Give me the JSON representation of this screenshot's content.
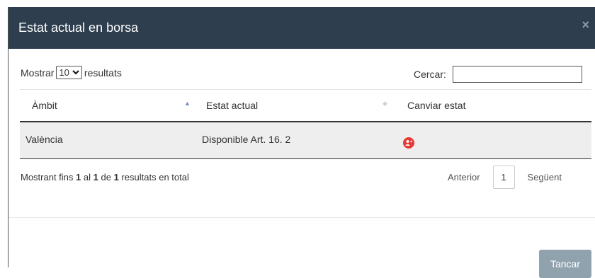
{
  "modal": {
    "title": "Estat actual en borsa",
    "close_glyph": "×",
    "footer_button": "Tancar"
  },
  "toolbar": {
    "show_prefix": "Mostrar",
    "show_value": "10",
    "show_suffix": "resultats",
    "search_label": "Cercar:",
    "search_value": ""
  },
  "table": {
    "columns": [
      "Àmbit",
      "Estat actual",
      "Canviar estat"
    ],
    "sort": {
      "column": "Àmbit",
      "direction": "asc"
    },
    "rows": [
      {
        "ambit": "València",
        "estat": "Disponible Art. 16. 2",
        "action_icon": "user-change-icon"
      }
    ]
  },
  "info": {
    "prefix": "Mostrant fins",
    "from": "1",
    "mid": "al",
    "to": "1",
    "mid2": "de",
    "total": "1",
    "suffix": "resultats en total"
  },
  "pagination": {
    "previous": "Anterior",
    "current": "1",
    "next": "Següent"
  },
  "colors": {
    "header_bg": "#2e3e4e",
    "row_bg": "#eeeeee",
    "action_icon": "#e53935",
    "button_bg": "#8fa2ad"
  }
}
